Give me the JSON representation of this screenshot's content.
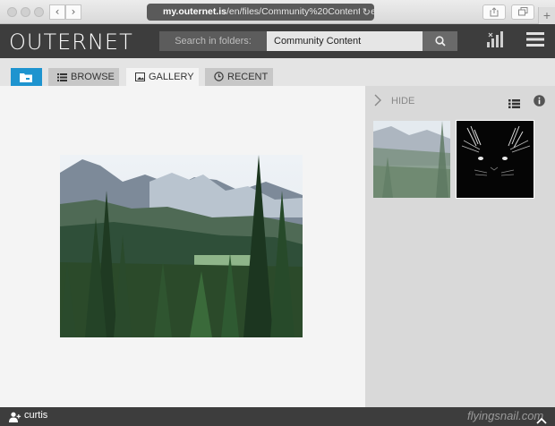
{
  "browser": {
    "url_host": "my.outernet.is",
    "url_path": "/en/files/Community%20Content?selec",
    "back_icon": "‹",
    "forward_icon": "›",
    "reload_icon": "↻",
    "new_tab_icon": "+"
  },
  "header": {
    "logo": "OUTERNET",
    "search_label": "Search in folders:",
    "search_value": "Community Content"
  },
  "tabs": [
    {
      "label": "BROWSE"
    },
    {
      "label": "GALLERY"
    },
    {
      "label": "RECENT"
    }
  ],
  "gallery": {
    "hide_label": "HIDE"
  },
  "footer": {
    "username": "curtis",
    "watermark": "flyingsnail.com"
  },
  "colors": {
    "accent": "#1e94cf",
    "header_bg": "#3d3d3d",
    "viewer_bg": "#f4f4f4",
    "panel_bg": "#d9d9d9"
  }
}
